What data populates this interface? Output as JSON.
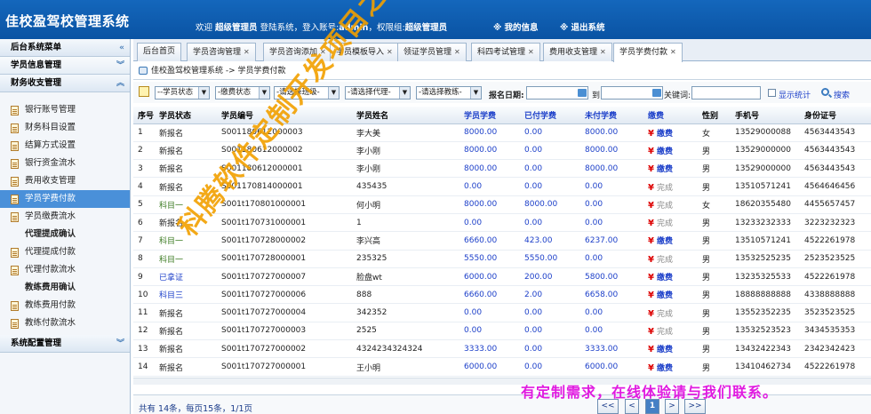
{
  "header": {
    "title": "佳校盈驾校管理系统",
    "welcome": "欢迎",
    "user_role": "超级管理员",
    "login_text": "登陆系统，登入账号:",
    "account": "admin",
    "perm_text": "，权限组:",
    "perm_group": "超级管理员",
    "my_info": "※ 我的信息",
    "logout": "※ 退出系统"
  },
  "sidebar": {
    "menu_title": "后台系统菜单",
    "sections": [
      {
        "label": "学员信息管理"
      },
      {
        "label": "财务收支管理"
      },
      {
        "label": "系统配置管理"
      }
    ],
    "items": [
      {
        "label": "银行账号管理"
      },
      {
        "label": "财务科目设置"
      },
      {
        "label": "结算方式设置"
      },
      {
        "label": "银行资金流水"
      },
      {
        "label": "费用收支管理"
      },
      {
        "label": "学员学费付款"
      },
      {
        "label": "学员缴费流水"
      },
      {
        "label": "代理提成确认"
      },
      {
        "label": "代理提成付款"
      },
      {
        "label": "代理付款流水"
      },
      {
        "label": "教练费用确认"
      },
      {
        "label": "教练费用付款"
      },
      {
        "label": "教练付款流水"
      }
    ]
  },
  "tabs": [
    {
      "label": "后台首页"
    },
    {
      "label": "学员咨询管理"
    },
    {
      "label": "学员咨询添加"
    },
    {
      "label": "学员模板导入"
    },
    {
      "label": "领证学员管理"
    },
    {
      "label": "科四考试管理"
    },
    {
      "label": "费用收支管理"
    },
    {
      "label": "学员学费付款"
    }
  ],
  "breadcrumb": "佳校盈驾校管理系统 -> 学员学费付款",
  "filters": {
    "student_status": "--学员状态",
    "pay_status": "-缴费状态",
    "class": "-请选择班级-",
    "agent": "-请选择代理-",
    "coach": "-请选择教练-",
    "date_label": "报名日期:",
    "to_label": "到",
    "keyword_label": "关键词:",
    "show_stats": "显示统计",
    "search": "搜索"
  },
  "table": {
    "columns": [
      "序号",
      "学员状态",
      "学员编号",
      "学员姓名",
      "学员学费",
      "已付学费",
      "未付学费",
      "缴费",
      "性别",
      "手机号",
      "身份证号"
    ],
    "rows": [
      {
        "no": "1",
        "status": "新报名",
        "sc": "",
        "id": "S001180612000003",
        "name": "李大美",
        "fee": "8000.00",
        "paid": "0.00",
        "unpaid": "8000.00",
        "pay": "缴费",
        "paid_state": "pay",
        "sex": "女",
        "phone": "13529000088",
        "idcard": "4563443543"
      },
      {
        "no": "2",
        "status": "新报名",
        "sc": "",
        "id": "S001180612000002",
        "name": "李小刚",
        "fee": "8000.00",
        "paid": "0.00",
        "unpaid": "8000.00",
        "pay": "缴费",
        "paid_state": "pay",
        "sex": "男",
        "phone": "13529000000",
        "idcard": "4563443543"
      },
      {
        "no": "3",
        "status": "新报名",
        "sc": "",
        "id": "S001180612000001",
        "name": "李小刚",
        "fee": "8000.00",
        "paid": "0.00",
        "unpaid": "8000.00",
        "pay": "缴费",
        "paid_state": "pay",
        "sex": "男",
        "phone": "13529000000",
        "idcard": "4563443543"
      },
      {
        "no": "4",
        "status": "新报名",
        "sc": "",
        "id": "S001170814000001",
        "name": "435435",
        "fee": "0.00",
        "paid": "0.00",
        "unpaid": "0.00",
        "pay": "完成",
        "paid_state": "done",
        "sex": "男",
        "phone": "13510571241",
        "idcard": "4564646456"
      },
      {
        "no": "5",
        "status": "科目一",
        "sc": "green",
        "id": "S001t170801000001",
        "name": "何小明",
        "fee": "8000.00",
        "paid": "8000.00",
        "unpaid": "0.00",
        "pay": "完成",
        "paid_state": "done",
        "sex": "女",
        "phone": "18620355480",
        "idcard": "4455657457"
      },
      {
        "no": "6",
        "status": "新报名",
        "sc": "",
        "id": "S001t170731000001",
        "name": "1",
        "fee": "0.00",
        "paid": "0.00",
        "unpaid": "0.00",
        "pay": "完成",
        "paid_state": "done",
        "sex": "男",
        "phone": "13233232333",
        "idcard": "3223232323"
      },
      {
        "no": "7",
        "status": "科目一",
        "sc": "green",
        "id": "S001t170728000002",
        "name": "李兴高",
        "fee": "6660.00",
        "paid": "423.00",
        "unpaid": "6237.00",
        "pay": "缴费",
        "paid_state": "pay",
        "sex": "男",
        "phone": "13510571241",
        "idcard": "4522261978"
      },
      {
        "no": "8",
        "status": "科目一",
        "sc": "green",
        "id": "S001t170728000001",
        "name": "235325",
        "fee": "5550.00",
        "paid": "5550.00",
        "unpaid": "0.00",
        "pay": "完成",
        "paid_state": "done",
        "sex": "男",
        "phone": "13532525235",
        "idcard": "2523523525"
      },
      {
        "no": "9",
        "status": "已拿证",
        "sc": "navy",
        "id": "S001t170727000007",
        "name": "脸盘wt",
        "fee": "6000.00",
        "paid": "200.00",
        "unpaid": "5800.00",
        "pay": "缴费",
        "paid_state": "pay",
        "sex": "男",
        "phone": "13235325533",
        "idcard": "4522261978"
      },
      {
        "no": "10",
        "status": "科目三",
        "sc": "navy",
        "id": "S001t170727000006",
        "name": "888",
        "fee": "6660.00",
        "paid": "2.00",
        "unpaid": "6658.00",
        "pay": "缴费",
        "paid_state": "pay",
        "sex": "男",
        "phone": "18888888888",
        "idcard": "4338888888"
      },
      {
        "no": "11",
        "status": "新报名",
        "sc": "",
        "id": "S001t170727000004",
        "name": "342352",
        "fee": "0.00",
        "paid": "0.00",
        "unpaid": "0.00",
        "pay": "完成",
        "paid_state": "done",
        "sex": "男",
        "phone": "13552352235",
        "idcard": "3523523525"
      },
      {
        "no": "12",
        "status": "新报名",
        "sc": "",
        "id": "S001t170727000003",
        "name": "2525",
        "fee": "0.00",
        "paid": "0.00",
        "unpaid": "0.00",
        "pay": "完成",
        "paid_state": "done",
        "sex": "男",
        "phone": "13532523523",
        "idcard": "3434535353"
      },
      {
        "no": "13",
        "status": "新报名",
        "sc": "",
        "id": "S001t170727000002",
        "name": "4324234324324",
        "fee": "3333.00",
        "paid": "0.00",
        "unpaid": "3333.00",
        "pay": "缴费",
        "paid_state": "pay",
        "sex": "男",
        "phone": "13432422343",
        "idcard": "2342342423"
      },
      {
        "no": "14",
        "status": "新报名",
        "sc": "",
        "id": "S001t170727000001",
        "name": "王小明",
        "fee": "6000.00",
        "paid": "0.00",
        "unpaid": "6000.00",
        "pay": "缴费",
        "paid_state": "pay",
        "sex": "男",
        "phone": "13410462734",
        "idcard": "4522261978"
      }
    ]
  },
  "footer": {
    "count_text": "共有 14条，每页15条，1/1页",
    "pages": [
      "<<",
      "<",
      "1",
      ">",
      ">>"
    ]
  },
  "watermark": {
    "diagonal": "科腾软件定制开发项目之一",
    "bottom": "有定制需求，在线体验请与我们联系。"
  },
  "colors": {
    "header_bg": "#1467bc",
    "link_blue": "#1c3fc9",
    "watermark_orange": "#f2a000",
    "watermark_magenta": "#e01ae0"
  }
}
